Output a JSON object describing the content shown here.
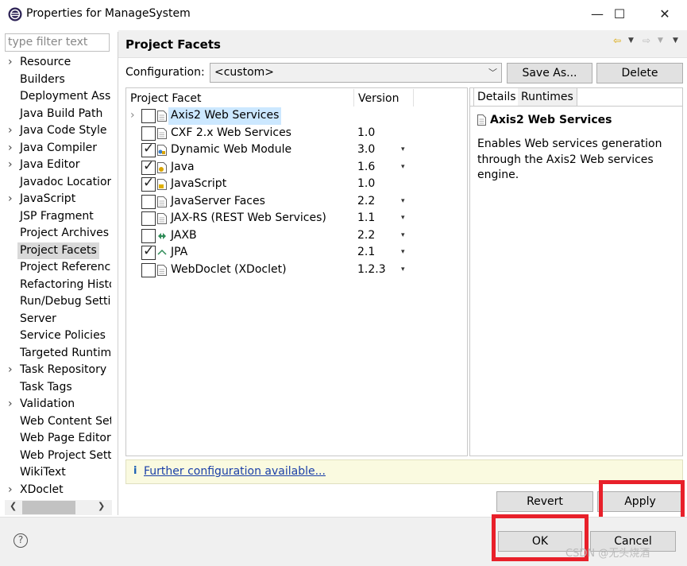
{
  "window": {
    "title": "Properties for ManageSystem",
    "minimize": "—",
    "maximize": "☐",
    "close": "✕"
  },
  "filter": {
    "placeholder": "type filter text"
  },
  "tree": [
    {
      "label": "Resource",
      "expandable": true
    },
    {
      "label": "Builders",
      "expandable": false
    },
    {
      "label": "Deployment Ass",
      "expandable": false
    },
    {
      "label": "Java Build Path",
      "expandable": false
    },
    {
      "label": "Java Code Style",
      "expandable": true
    },
    {
      "label": "Java Compiler",
      "expandable": true
    },
    {
      "label": "Java Editor",
      "expandable": true
    },
    {
      "label": "Javadoc Locatior",
      "expandable": false
    },
    {
      "label": "JavaScript",
      "expandable": true
    },
    {
      "label": "JSP Fragment",
      "expandable": false
    },
    {
      "label": "Project Archives",
      "expandable": false
    },
    {
      "label": "Project Facets",
      "expandable": false,
      "selected": true
    },
    {
      "label": "Project Referenc",
      "expandable": false
    },
    {
      "label": "Refactoring Histo",
      "expandable": false
    },
    {
      "label": "Run/Debug Setti",
      "expandable": false
    },
    {
      "label": "Server",
      "expandable": false
    },
    {
      "label": "Service Policies",
      "expandable": false
    },
    {
      "label": "Targeted Runtim",
      "expandable": false
    },
    {
      "label": "Task Repository",
      "expandable": true
    },
    {
      "label": "Task Tags",
      "expandable": false
    },
    {
      "label": "Validation",
      "expandable": true
    },
    {
      "label": "Web Content Set",
      "expandable": false
    },
    {
      "label": "Web Page Editor",
      "expandable": false
    },
    {
      "label": "Web Project Sett",
      "expandable": false
    },
    {
      "label": "WikiText",
      "expandable": false
    },
    {
      "label": "XDoclet",
      "expandable": true
    }
  ],
  "page": {
    "title": "Project Facets"
  },
  "configuration": {
    "label": "Configuration:",
    "value": "<custom>",
    "save_as": "Save As...",
    "delete": "Delete"
  },
  "facets": {
    "col_facet": "Project Facet",
    "col_version": "Version",
    "rows": [
      {
        "name": "Axis2 Web Services",
        "version": "",
        "checked": false,
        "expandable": true,
        "selected": true,
        "has_dropdown": false
      },
      {
        "name": "CXF 2.x Web Services",
        "version": "1.0",
        "checked": false,
        "expandable": false,
        "has_dropdown": false
      },
      {
        "name": "Dynamic Web Module",
        "version": "3.0",
        "checked": true,
        "expandable": false,
        "has_dropdown": true
      },
      {
        "name": "Java",
        "version": "1.6",
        "checked": true,
        "expandable": false,
        "has_dropdown": true
      },
      {
        "name": "JavaScript",
        "version": "1.0",
        "checked": true,
        "expandable": false,
        "has_dropdown": false
      },
      {
        "name": "JavaServer Faces",
        "version": "2.2",
        "checked": false,
        "expandable": false,
        "has_dropdown": true
      },
      {
        "name": "JAX-RS (REST Web Services)",
        "version": "1.1",
        "checked": false,
        "expandable": false,
        "has_dropdown": true
      },
      {
        "name": "JAXB",
        "version": "2.2",
        "checked": false,
        "expandable": false,
        "has_dropdown": true
      },
      {
        "name": "JPA",
        "version": "2.1",
        "checked": true,
        "expandable": false,
        "has_dropdown": true
      },
      {
        "name": "WebDoclet (XDoclet)",
        "version": "1.2.3",
        "checked": false,
        "expandable": false,
        "has_dropdown": true
      }
    ]
  },
  "details": {
    "tab_details": "Details",
    "tab_runtimes": "Runtimes",
    "title": "Axis2 Web Services",
    "description": "Enables Web services generation through the Axis2 Web services engine."
  },
  "info": {
    "icon": "i",
    "link": "Further configuration available..."
  },
  "buttons": {
    "revert": "Revert",
    "apply": "Apply",
    "ok": "OK",
    "cancel": "Cancel"
  },
  "help": "?",
  "watermark": "CSDN @无头烧酒",
  "colors": {
    "highlight": "#e8202a",
    "link": "#1a3fa8",
    "selection": "#cce8ff"
  }
}
